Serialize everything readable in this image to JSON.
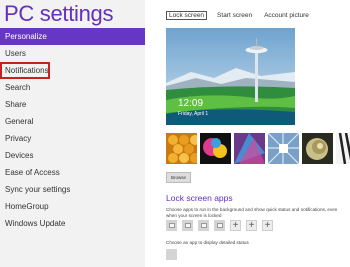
{
  "app": {
    "title": "PC settings"
  },
  "sidebar": {
    "items": [
      {
        "label": "Personalize"
      },
      {
        "label": "Users"
      },
      {
        "label": "Notifications"
      },
      {
        "label": "Search"
      },
      {
        "label": "Share"
      },
      {
        "label": "General"
      },
      {
        "label": "Privacy"
      },
      {
        "label": "Devices"
      },
      {
        "label": "Ease of Access"
      },
      {
        "label": "Sync your settings"
      },
      {
        "label": "HomeGroup"
      },
      {
        "label": "Windows Update"
      }
    ],
    "selected_index": 0,
    "highlighted_index": 2,
    "selected_color": "#6636c4",
    "highlight_color": "#cc1f1f"
  },
  "tabs": [
    {
      "label": "Lock screen"
    },
    {
      "label": "Start screen"
    },
    {
      "label": "Account picture"
    }
  ],
  "preview": {
    "time": "12:09",
    "date": "Friday, April 1"
  },
  "browse_button": {
    "label": "Browse"
  },
  "lock_apps": {
    "title": "Lock screen apps",
    "description": "Choose apps to run in the background and show quick status and notifications, even when your screen is locked",
    "plus_label": "+",
    "detailed_description": "Choose an app to display detailed status"
  },
  "accent_color": "#6330c0"
}
